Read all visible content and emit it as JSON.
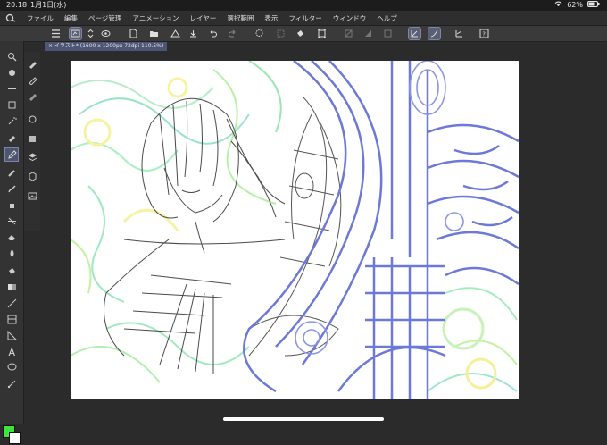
{
  "status_bar": {
    "time": "20:18",
    "date": "1月1日(水)",
    "battery": "62%"
  },
  "menu": [
    "ファイル",
    "編集",
    "ページ管理",
    "アニメーション",
    "レイヤー",
    "選択範囲",
    "表示",
    "フィルター",
    "ウィンドウ",
    "ヘルプ"
  ],
  "document_tab": {
    "label": "× イラスト* (1600 x 1200px 72dpi 110.5%)"
  },
  "colors": {
    "main_color": "#39e639",
    "sub_color": "#ffffff",
    "accent": "#7d85a8"
  },
  "toolbar_icons": [
    "menu-icon",
    "canvas-view-icon",
    "brush-size-icon",
    "new-file-icon",
    "open-file-icon",
    "undo-icon",
    "redo-icon",
    "lasso-icon",
    "fill-icon",
    "transform-icon",
    "crop-icon",
    "clear-icon",
    "stabilizer-icon",
    "help-icon"
  ],
  "tools": [
    "zoom-icon",
    "move-icon",
    "select-icon",
    "lasso-icon",
    "eyedropper-icon",
    "pen-icon",
    "pencil-icon",
    "brush-icon",
    "airbrush-icon",
    "eraser-icon",
    "blend-icon",
    "fill-icon",
    "gradient-icon",
    "shape-icon",
    "frame-icon",
    "text-icon",
    "balloon-icon",
    "ruler-icon"
  ]
}
